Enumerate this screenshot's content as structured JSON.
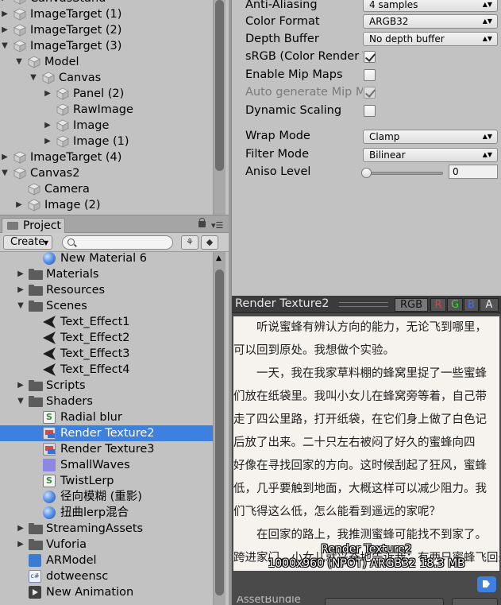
{
  "hierarchy": {
    "items": [
      {
        "label": "CanvasStand",
        "expanded": false,
        "has_children": true
      },
      {
        "label": "ImageTarget (1)",
        "expanded": false,
        "has_children": true
      },
      {
        "label": "ImageTarget (2)",
        "expanded": false,
        "has_children": true
      },
      {
        "label": "ImageTarget (3)",
        "expanded": true,
        "has_children": true
      },
      {
        "label": "Model",
        "expanded": true,
        "has_children": true
      },
      {
        "label": "Canvas",
        "expanded": true,
        "has_children": true
      },
      {
        "label": "Panel (2)",
        "expanded": false,
        "has_children": true
      },
      {
        "label": "RawImage",
        "expanded": false,
        "has_children": false
      },
      {
        "label": "Image",
        "expanded": false,
        "has_children": true
      },
      {
        "label": "Image (1)",
        "expanded": false,
        "has_children": true
      },
      {
        "label": "ImageTarget (4)",
        "expanded": false,
        "has_children": true
      },
      {
        "label": "Canvas2",
        "expanded": true,
        "has_children": true
      },
      {
        "label": "Camera",
        "expanded": false,
        "has_children": false
      },
      {
        "label": "Image (2)",
        "expanded": false,
        "has_children": true
      }
    ]
  },
  "project": {
    "tab_label": "Project",
    "create_label": "Create",
    "search_placeholder": "",
    "items": [
      {
        "label": "New Material 6",
        "icon": "material-sphere-icon",
        "expanded": false,
        "has_children": false,
        "selected": false
      },
      {
        "label": "Materials",
        "icon": "folder-icon",
        "expanded": false,
        "has_children": true,
        "selected": false
      },
      {
        "label": "Resources",
        "icon": "folder-icon",
        "expanded": false,
        "has_children": true,
        "selected": false
      },
      {
        "label": "Scenes",
        "icon": "folder-icon",
        "expanded": true,
        "has_children": true,
        "selected": false
      },
      {
        "label": "Text_Effect1",
        "icon": "unity-scene-icon",
        "expanded": false,
        "has_children": false,
        "selected": false
      },
      {
        "label": "Text_Effect2",
        "icon": "unity-scene-icon",
        "expanded": false,
        "has_children": false,
        "selected": false
      },
      {
        "label": "Text_Effect3",
        "icon": "unity-scene-icon",
        "expanded": false,
        "has_children": false,
        "selected": false
      },
      {
        "label": "Text_Effect4",
        "icon": "unity-scene-icon",
        "expanded": false,
        "has_children": false,
        "selected": false
      },
      {
        "label": "Scripts",
        "icon": "folder-icon",
        "expanded": false,
        "has_children": true,
        "selected": false
      },
      {
        "label": "Shaders",
        "icon": "folder-icon",
        "expanded": true,
        "has_children": true,
        "selected": false
      },
      {
        "label": "Radial blur",
        "icon": "shader-icon",
        "expanded": false,
        "has_children": false,
        "selected": false
      },
      {
        "label": "Render Texture2",
        "icon": "render-texture-icon",
        "expanded": false,
        "has_children": false,
        "selected": true
      },
      {
        "label": "Render Texture3",
        "icon": "render-texture-icon",
        "expanded": false,
        "has_children": false,
        "selected": false
      },
      {
        "label": "SmallWaves",
        "icon": "texture-icon",
        "expanded": false,
        "has_children": false,
        "selected": false
      },
      {
        "label": "TwistLerp",
        "icon": "shader-icon",
        "expanded": false,
        "has_children": false,
        "selected": false
      },
      {
        "label": "径向模糊 (重影)",
        "icon": "material-sphere-icon",
        "expanded": false,
        "has_children": false,
        "selected": false
      },
      {
        "label": "扭曲lerp混合",
        "icon": "material-sphere-icon",
        "expanded": false,
        "has_children": false,
        "selected": false
      },
      {
        "label": "StreamingAssets",
        "icon": "folder-icon",
        "expanded": false,
        "has_children": true,
        "selected": false
      },
      {
        "label": "Vuforia",
        "icon": "folder-icon",
        "expanded": false,
        "has_children": true,
        "selected": false
      },
      {
        "label": "ARModel",
        "icon": "prefab-icon",
        "expanded": false,
        "has_children": false,
        "selected": false
      },
      {
        "label": "dotweensc",
        "icon": "csharp-script-icon",
        "expanded": false,
        "has_children": false,
        "selected": false
      },
      {
        "label": "New Animation",
        "icon": "animation-clip-icon",
        "expanded": false,
        "has_children": false,
        "selected": false
      }
    ]
  },
  "inspector": {
    "anti_aliasing": {
      "label": "Anti-Aliasing",
      "value": "4 samples"
    },
    "color_format": {
      "label": "Color Format",
      "value": "ARGB32"
    },
    "depth_buffer": {
      "label": "Depth Buffer",
      "value": "No depth buffer"
    },
    "srgb": {
      "label": "sRGB (Color Render Texture)",
      "checked": true
    },
    "mipmaps": {
      "label": "Enable Mip Maps",
      "checked": false
    },
    "auto_mip": {
      "label": "Auto generate Mip Maps",
      "checked": true,
      "disabled": true
    },
    "dynamic_scaling": {
      "label": "Dynamic Scaling",
      "checked": false
    },
    "wrap_mode": {
      "label": "Wrap Mode",
      "value": "Clamp"
    },
    "filter_mode": {
      "label": "Filter Mode",
      "value": "Bilinear"
    },
    "aniso": {
      "label": "Aniso Level",
      "value": "0",
      "fraction": 0
    }
  },
  "preview": {
    "title": "Render Texture2",
    "channels": [
      "RGB",
      "R",
      "G",
      "B",
      "A"
    ],
    "active_channel": "RGB",
    "channel_colors": {
      "RGB": "#dddddd",
      "R": "#e04040",
      "G": "#3fcf3f",
      "B": "#4a6ef0",
      "A": "#eeeeee"
    },
    "text_lines": [
      "　　听说蜜蜂有辨认方向的能力，无论飞到哪里，",
      "可以回到原处。我想做个实验。",
      "　　一天，我在我家草料棚的蜂窝里捉了一些蜜蜂",
      "们放在纸袋里。我叫小女儿在蜂窝旁等着，自己带",
      "走了四公里路，打开纸袋，在它们身上做了白色记",
      "后放了出来。二十只左右被闷了好久的蜜蜂向四",
      "好像在寻找回家的方向。这时候刮起了狂风，蜜蜂",
      "低，几乎要触到地面，大概这样可以减少阻力。我",
      "们飞得这么低，怎么能看到遥远的家呢？",
      "　　在回家的路上，我推测蜜蜂可能找不到家了。",
      "跨进家门，小女儿就兴奋地告诉我：有两只蜜蜂飞回来了，正是头上去"
    ],
    "overlay_name": "Render Texture2",
    "overlay_info": "1000x960 (NPOT)  ARGB32  18.3 MB",
    "asset_bundle_label": "AssetBundle"
  }
}
